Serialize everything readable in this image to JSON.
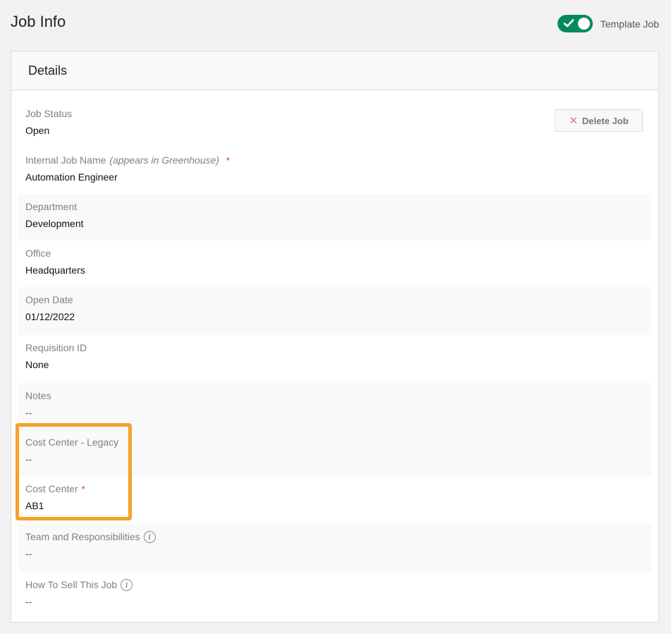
{
  "header": {
    "title": "Job Info",
    "template_toggle": {
      "label": "Template Job",
      "on": true,
      "accent": "#048a5e"
    }
  },
  "card": {
    "title": "Details",
    "delete_button": {
      "label": "Delete Job",
      "icon": "close-icon"
    },
    "fields": [
      {
        "id": "job-status",
        "label": "Job Status",
        "value": "Open"
      },
      {
        "id": "internal-job-name",
        "label": "Internal Job Name",
        "label_note": "(appears in Greenhouse)",
        "required": true,
        "value": "Automation Engineer"
      },
      {
        "id": "department",
        "label": "Department",
        "value": "Development"
      },
      {
        "id": "office",
        "label": "Office",
        "value": "Headquarters"
      },
      {
        "id": "open-date",
        "label": "Open Date",
        "value": "01/12/2022"
      },
      {
        "id": "requisition-id",
        "label": "Requisition ID",
        "value": "None"
      },
      {
        "id": "notes",
        "label": "Notes",
        "value": "--"
      },
      {
        "id": "cost-center-legacy",
        "label": "Cost Center - Legacy",
        "value": "--"
      },
      {
        "id": "cost-center",
        "label": "Cost Center",
        "required": true,
        "value": "AB1"
      },
      {
        "id": "team-responsibilities",
        "label": "Team and Responsibilities",
        "info": true,
        "value": "--"
      },
      {
        "id": "how-to-sell",
        "label": "How To Sell This Job",
        "info": true,
        "value": "--"
      }
    ],
    "required_marker": "*",
    "info_glyph": "i"
  },
  "highlight": {
    "color": "#f6a226",
    "target": "cost-center-fields"
  }
}
